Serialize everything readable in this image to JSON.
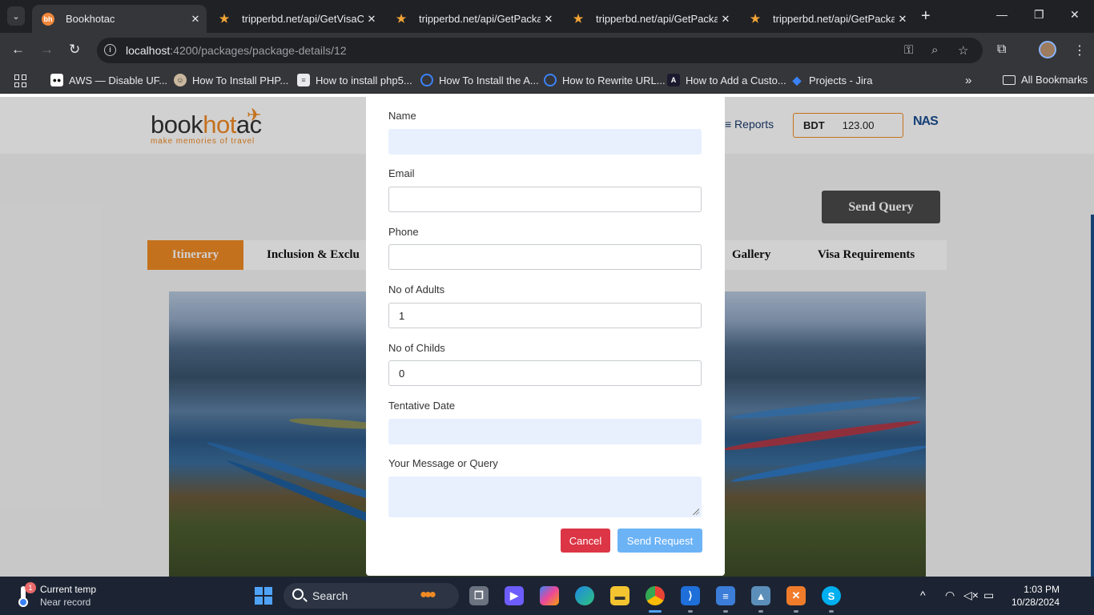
{
  "browser": {
    "tabs": [
      {
        "title": "Bookhotac",
        "favicon": "bh",
        "active": true
      },
      {
        "title": "tripperbd.net/api/GetVisaCo",
        "favicon": "tripper-icon",
        "active": false
      },
      {
        "title": "tripperbd.net/api/GetPackag",
        "favicon": "tripper-icon",
        "active": false
      },
      {
        "title": "tripperbd.net/api/GetPackag",
        "favicon": "tripper-icon",
        "active": false
      },
      {
        "title": "tripperbd.net/api/GetPackag",
        "favicon": "tripper-icon",
        "active": false
      }
    ],
    "url_host": "localhost",
    "url_path": ":4200/packages/package-details/12",
    "bookmarks": [
      {
        "label": "AWS — Disable UF..."
      },
      {
        "label": "How To Install PHP..."
      },
      {
        "label": "How to install php5..."
      },
      {
        "label": "How To Install the A..."
      },
      {
        "label": "How to Rewrite URL..."
      },
      {
        "label": "How to Add a Custo..."
      },
      {
        "label": "Projects - Jira"
      }
    ],
    "all_bookmarks": "All Bookmarks"
  },
  "site": {
    "logo_book": "book",
    "logo_hot": "hot",
    "logo_ac": "ac",
    "tagline": "make memories of travel",
    "reports_label": "≡ Reports",
    "currency": "BDT",
    "balance": "123.00",
    "partner_logo": "NAS",
    "send_query_label": "Send Query",
    "tabs": [
      "Itinerary",
      "Inclusion & Exclu",
      "Gallery",
      "Visa Requirements"
    ]
  },
  "modal": {
    "fields": [
      {
        "label": "Name",
        "value": ""
      },
      {
        "label": "Email",
        "value": ""
      },
      {
        "label": "Phone",
        "value": ""
      },
      {
        "label": "No of Adults",
        "value": "1"
      },
      {
        "label": "No of Childs",
        "value": "0"
      },
      {
        "label": "Tentative Date",
        "value": ""
      },
      {
        "label": "Your Message or Query",
        "value": ""
      }
    ],
    "cancel_label": "Cancel",
    "send_label": "Send Request"
  },
  "taskbar": {
    "weather_badge": "1",
    "weather_title": "Current temp",
    "weather_sub": "Near record",
    "search_placeholder": "Search",
    "time": "1:03 PM",
    "date": "10/28/2024"
  },
  "colors": {
    "brand_orange": "#f08a24",
    "cancel_red": "#dc3545",
    "send_blue": "#6cb3f6",
    "autofill_bg": "#e8f0fe"
  }
}
